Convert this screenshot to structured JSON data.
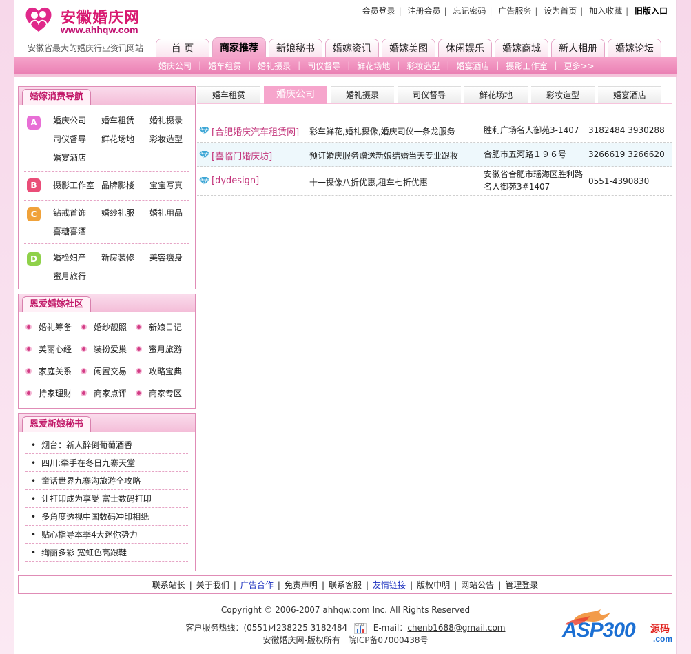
{
  "site": {
    "logo_cn": "安徽婚庆网",
    "logo_url": "www.ahhqw.com",
    "slogan": "安徽省最大的婚庆行业资讯网站"
  },
  "toplinks": [
    "会员登录",
    "注册会员",
    "忘记密码",
    "广告服务",
    "设为首页",
    "加入收藏"
  ],
  "toplinks_bold": "旧版入口",
  "main_tabs": [
    {
      "label": "首 页"
    },
    {
      "label": "商家推荐"
    },
    {
      "label": "新娘秘书"
    },
    {
      "label": "婚嫁资讯"
    },
    {
      "label": "婚嫁美图"
    },
    {
      "label": "休闲娱乐"
    },
    {
      "label": "婚嫁商城"
    },
    {
      "label": "新人相册"
    },
    {
      "label": "婚嫁论坛"
    }
  ],
  "sub_nav": [
    "婚庆公司",
    "婚车租赁",
    "婚礼摄录",
    "司仪督导",
    "鲜花场地",
    "彩妆造型",
    "婚宴酒店",
    "摄影工作室"
  ],
  "sub_nav_more": "更多>>",
  "consume_nav": {
    "title": "婚嫁消费导航",
    "groups": [
      {
        "badge": "A",
        "color": "#e86fd6",
        "items": [
          "婚庆公司",
          "婚车租赁",
          "婚礼摄录",
          "司仪督导",
          "鲜花场地",
          "彩妆造型",
          "婚宴酒店"
        ]
      },
      {
        "badge": "B",
        "color": "#ea4d78",
        "items": [
          "摄影工作室",
          "品牌影楼",
          "宝宝写真"
        ]
      },
      {
        "badge": "C",
        "color": "#f0a23a",
        "items": [
          "钻戒首饰",
          "婚纱礼服",
          "婚礼用品",
          "喜糖喜酒"
        ]
      },
      {
        "badge": "D",
        "color": "#8fd14a",
        "items": [
          "婚检妇产",
          "新房装修",
          "美容瘦身",
          "蜜月旅行"
        ]
      }
    ]
  },
  "community": {
    "title": "恩爱婚嫁社区",
    "items": [
      "婚礼筹备",
      "婚纱靓照",
      "新娘日记",
      "美丽心经",
      "装扮爱巢",
      "蜜月旅游",
      "家庭关系",
      "闲置交易",
      "攻略宝典",
      "持家理财",
      "商家点评",
      "商家专区"
    ]
  },
  "secretary": {
    "title": "恩爱新娘秘书",
    "items": [
      "烟台：新人醉倒葡萄酒香",
      "四川:牵手在冬日九寨天堂",
      "童话世界九寨沟旅游全攻略",
      "让打印成为享受  富士数码打印",
      "多角度透视中国数码冲印相纸",
      "贴心指导本季4大迷你势力",
      "绚丽多彩 宽虹色高跟鞋"
    ]
  },
  "content_tabs": [
    {
      "label": "婚车租赁"
    },
    {
      "label": "婚庆公司"
    },
    {
      "label": "婚礼摄录"
    },
    {
      "label": "司仪督导"
    },
    {
      "label": "鲜花场地"
    },
    {
      "label": "彩妆造型"
    },
    {
      "label": "婚宴酒店"
    }
  ],
  "listings": [
    {
      "name": "[合肥婚庆汽车租赁网]",
      "desc": "彩车鲜花,婚礼摄像,婚庆司仪一条龙服务",
      "addr": "胜利广场名人御苑3-1407",
      "tel": "3182484 3930288"
    },
    {
      "name": "[喜临门婚庆坊]",
      "desc": "预订婚庆服务赠送新娘结婚当天专业跟妆",
      "addr": "合肥市五河路１９６号",
      "tel": "3266619 3266620"
    },
    {
      "name": "[dydesign]",
      "desc": "十一摄像八折优惠,租车七折优惠",
      "addr": "安徽省合肥市瑶海区胜利路名人御苑3#1407",
      "tel": "0551-4390830"
    }
  ],
  "footer_nav": [
    "联系站长",
    "关于我们",
    "广告合作",
    "免责声明",
    "联系客服",
    "友情链接",
    "版权申明",
    "网站公告",
    "管理登录"
  ],
  "footer": {
    "copyright": "Copyright © 2006-2007 ahhqw.com Inc. All Rights Reserved",
    "hotline": "客户服务热线：(0551)4238225 3182484",
    "email_label": "E-mail：",
    "email": "chenb1688@gmail.com",
    "rights": "安徽婚庆网-版权所有",
    "icp": "皖ICP备07000438号",
    "cnzz": "cnzz"
  },
  "watermark": {
    "brand": "ASP300",
    "tag": "源码",
    "domain": ".com"
  }
}
